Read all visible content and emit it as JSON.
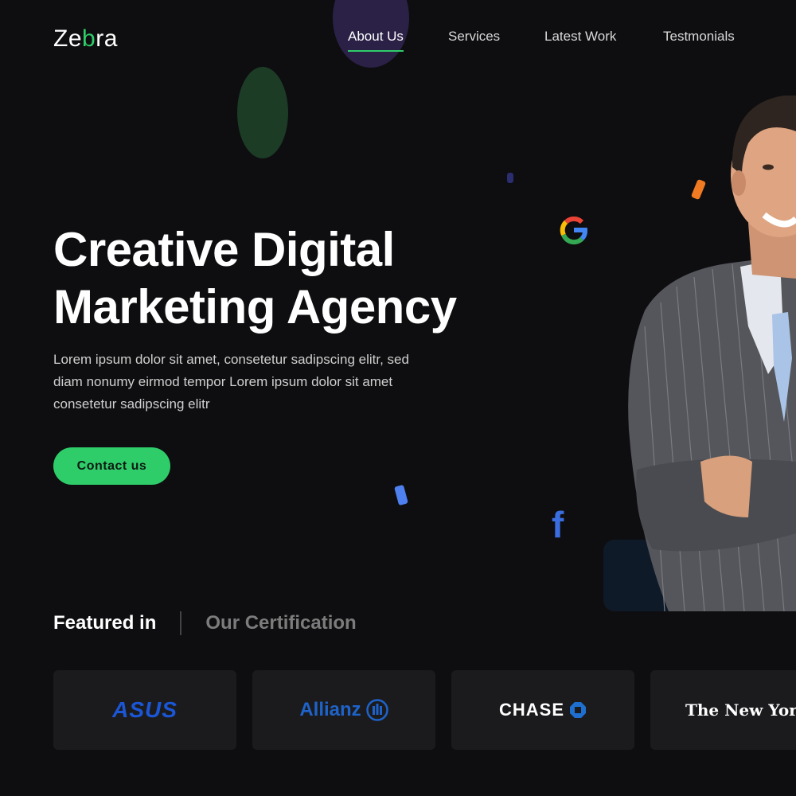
{
  "brand": {
    "logo_prefix": "Ze",
    "logo_accent": "b",
    "logo_suffix": "ra",
    "accent_color": "#2fcd6a"
  },
  "nav": [
    {
      "label": "About Us",
      "active": true
    },
    {
      "label": "Services",
      "active": false
    },
    {
      "label": "Latest Work",
      "active": false
    },
    {
      "label": "Testmonials",
      "active": false
    }
  ],
  "hero": {
    "title_line1": "Creative Digital",
    "title_line2": "Marketing Agency",
    "description": "Lorem ipsum dolor sit amet, consetetur sadipscing elitr, sed diam nonumy eirmod tempor Lorem ipsum dolor sit amet consetetur sadipscing elitr",
    "cta_label": "Contact us"
  },
  "social_icons": [
    "google-icon",
    "facebook-icon"
  ],
  "featured": {
    "tab_active": "Featured in",
    "tab_inactive": "Our Certification",
    "logos": [
      "ASUS",
      "Allianz",
      "CHASE",
      "The New York Times"
    ]
  },
  "colors": {
    "background": "#0e0e10",
    "accent": "#2fcd6a",
    "card": "#1b1b1d"
  }
}
